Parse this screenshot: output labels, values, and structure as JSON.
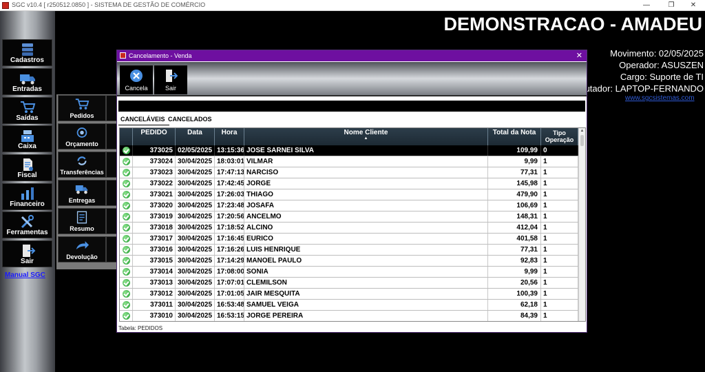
{
  "window": {
    "title": "SGC v10.4 [ r250512.0850 ] - SISTEMA DE GESTÃO DE COMÉRCIO",
    "minimize": "—",
    "maximize": "❐",
    "close": "✕"
  },
  "sidebar": {
    "items": [
      {
        "label": "Cadastros",
        "icon": "database-icon"
      },
      {
        "label": "Entradas",
        "icon": "truck-icon"
      },
      {
        "label": "Saídas",
        "icon": "cart-icon"
      },
      {
        "label": "Caixa",
        "icon": "cash-register-icon"
      },
      {
        "label": "Fiscal",
        "icon": "document-icon"
      },
      {
        "label": "Financeiro",
        "icon": "chart-icon"
      },
      {
        "label": "Ferramentas",
        "icon": "tools-icon"
      },
      {
        "label": "Sair",
        "icon": "exit-door-icon"
      }
    ],
    "manual_link": "Manual SGC"
  },
  "header": {
    "company": "DEMONSTRACAO - AMADEU",
    "movimento": "Movimento: 02/05/2025",
    "operador": "Operador: ASUSZEN",
    "cargo": "Cargo: Suporte de TI",
    "computador": "utador: LAPTOP-FERNANDO",
    "site": "www.sgcsistemas.com"
  },
  "submenu": {
    "items": [
      {
        "label": "Pedidos",
        "icon": "cart-icon"
      },
      {
        "label": "Orçamento",
        "icon": "budget-icon"
      },
      {
        "label": "Transferências",
        "icon": "transfer-icon"
      },
      {
        "label": "Entregas",
        "icon": "delivery-icon"
      },
      {
        "label": "Resumo",
        "icon": "summary-icon"
      },
      {
        "label": "Devolução",
        "icon": "return-arrow-icon"
      }
    ]
  },
  "dialog": {
    "title": "Cancelamento - Venda",
    "close": "✕",
    "toolbar": {
      "cancel_label": "Cancela",
      "exit_label": "Sair"
    },
    "tabs": [
      "CANCELÁVEIS",
      "CANCELADOS"
    ],
    "active_tab": 0,
    "columns": [
      "PEDIDO",
      "Data",
      "Hora",
      "Nome Cliente",
      "Total da Nota",
      "Tipo Operação"
    ],
    "sort_indicator": "▲",
    "rows": [
      {
        "pedido": "373025",
        "data": "02/05/2025",
        "hora": "13:15:36",
        "cliente": "JOSE SARNEI SILVA",
        "total": "109,99",
        "tipo": "0",
        "selected": true
      },
      {
        "pedido": "373024",
        "data": "30/04/2025",
        "hora": "18:03:01",
        "cliente": "VILMAR",
        "total": "9,99",
        "tipo": "1"
      },
      {
        "pedido": "373023",
        "data": "30/04/2025",
        "hora": "17:47:13",
        "cliente": "NARCISO",
        "total": "77,31",
        "tipo": "1"
      },
      {
        "pedido": "373022",
        "data": "30/04/2025",
        "hora": "17:42:45",
        "cliente": "JORGE",
        "total": "145,98",
        "tipo": "1"
      },
      {
        "pedido": "373021",
        "data": "30/04/2025",
        "hora": "17:26:03",
        "cliente": "THIAGO",
        "total": "479,90",
        "tipo": "1"
      },
      {
        "pedido": "373020",
        "data": "30/04/2025",
        "hora": "17:23:48",
        "cliente": "JOSAFA",
        "total": "106,69",
        "tipo": "1"
      },
      {
        "pedido": "373019",
        "data": "30/04/2025",
        "hora": "17:20:56",
        "cliente": "ANCELMO",
        "total": "148,31",
        "tipo": "1"
      },
      {
        "pedido": "373018",
        "data": "30/04/2025",
        "hora": "17:18:52",
        "cliente": "ALCINO",
        "total": "412,04",
        "tipo": "1"
      },
      {
        "pedido": "373017",
        "data": "30/04/2025",
        "hora": "17:16:45",
        "cliente": "EURICO",
        "total": "401,58",
        "tipo": "1"
      },
      {
        "pedido": "373016",
        "data": "30/04/2025",
        "hora": "17:16:26",
        "cliente": "LUIS HENRIQUE",
        "total": "77,31",
        "tipo": "1"
      },
      {
        "pedido": "373015",
        "data": "30/04/2025",
        "hora": "17:14:29",
        "cliente": "MANOEL PAULO",
        "total": "92,83",
        "tipo": "1"
      },
      {
        "pedido": "373014",
        "data": "30/04/2025",
        "hora": "17:08:00",
        "cliente": "SONIA",
        "total": "9,99",
        "tipo": "1"
      },
      {
        "pedido": "373013",
        "data": "30/04/2025",
        "hora": "17:07:01",
        "cliente": "CLEMILSON",
        "total": "20,56",
        "tipo": "1"
      },
      {
        "pedido": "373012",
        "data": "30/04/2025",
        "hora": "17:01:05",
        "cliente": "JAIR MESQUITA",
        "total": "100,39",
        "tipo": "1"
      },
      {
        "pedido": "373011",
        "data": "30/04/2025",
        "hora": "16:53:48",
        "cliente": "SAMUEL VEIGA",
        "total": "62,18",
        "tipo": "1"
      },
      {
        "pedido": "373010",
        "data": "30/04/2025",
        "hora": "16:53:15",
        "cliente": "JORGE PEREIRA",
        "total": "84,39",
        "tipo": "1"
      }
    ],
    "status": "Tabela: PEDIDOS"
  },
  "colors": {
    "dialog_title": "#6e0fa0",
    "check_green": "#1c9a2c",
    "link_blue": "#1a1aff",
    "grid_header": "#1d2a34"
  }
}
